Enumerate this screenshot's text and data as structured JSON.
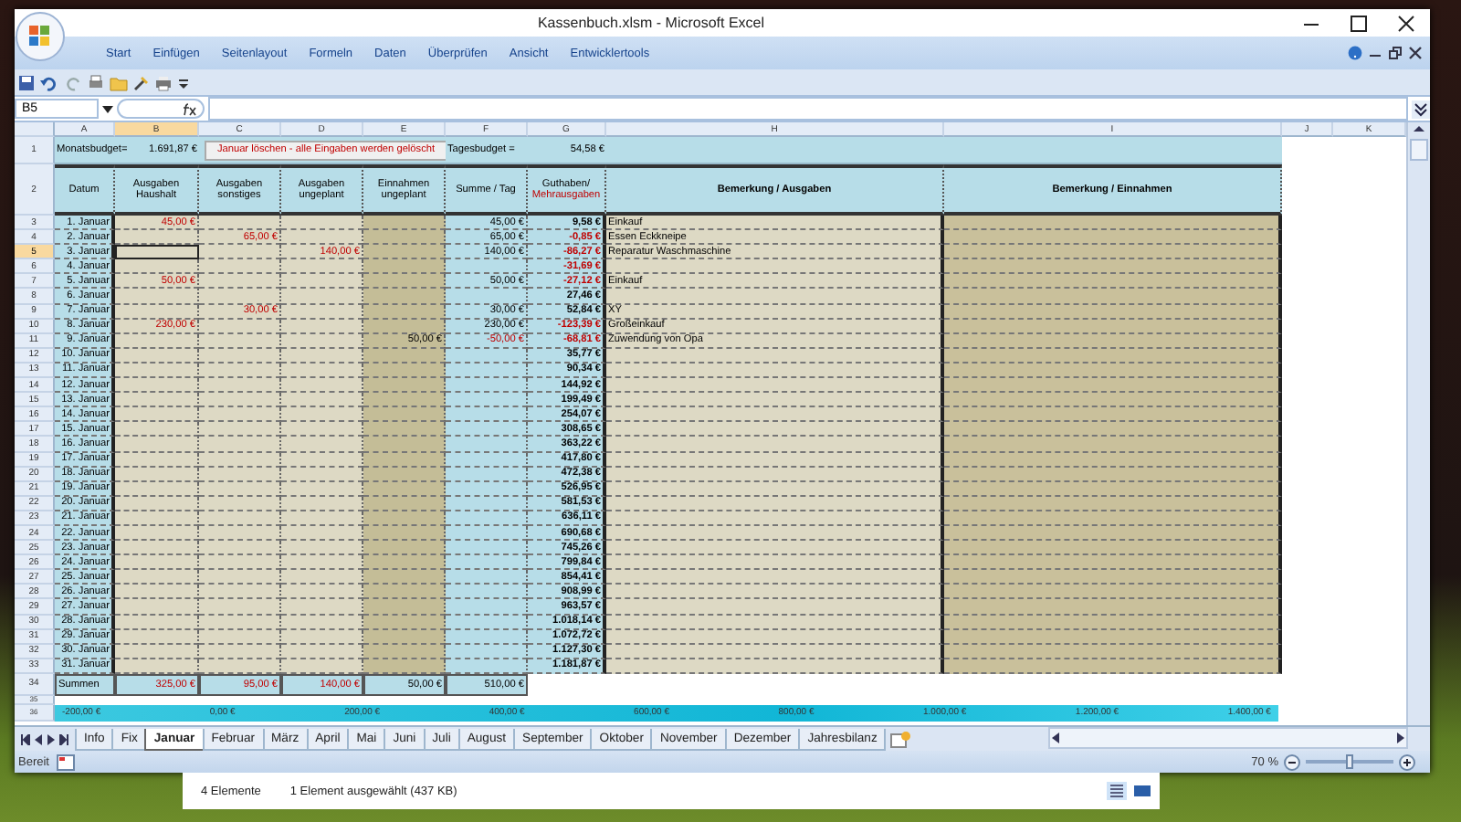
{
  "window": {
    "title": "Kassenbuch.xlsm - Microsoft Excel"
  },
  "ribbon_tabs": [
    {
      "label": "Start",
      "selected": false
    },
    {
      "label": "Einfügen",
      "selected": false
    },
    {
      "label": "Seitenlayout",
      "selected": false
    },
    {
      "label": "Formeln",
      "selected": false
    },
    {
      "label": "Daten",
      "selected": false
    },
    {
      "label": "Überprüfen",
      "selected": false
    },
    {
      "label": "Ansicht",
      "selected": false
    },
    {
      "label": "Entwicklertools",
      "selected": false
    }
  ],
  "formula_bar": {
    "name_box": "B5"
  },
  "columns": [
    {
      "label": "A",
      "selected": false
    },
    {
      "label": "B",
      "selected": true
    },
    {
      "label": "C",
      "selected": false
    },
    {
      "label": "D",
      "selected": false
    },
    {
      "label": "E",
      "selected": false
    },
    {
      "label": "F",
      "selected": false
    },
    {
      "label": "G",
      "selected": false
    },
    {
      "label": "H",
      "selected": false
    },
    {
      "label": "I",
      "selected": false
    },
    {
      "label": "J",
      "selected": false
    },
    {
      "label": "K",
      "selected": false
    }
  ],
  "budget_row": {
    "row": "1",
    "label": "Monatsbudget=",
    "value": "1.691,87 €",
    "button": "Januar löschen - alle Eingaben werden gelöscht",
    "day_label": "Tagesbudget =",
    "day_value": "54,58 €"
  },
  "header_row": {
    "row": "2",
    "headers": [
      {
        "text": "Datum",
        "bold": false
      },
      {
        "text": "Ausgaben Haushalt",
        "bold": false
      },
      {
        "text": "Ausgaben sonstiges",
        "bold": false
      },
      {
        "text": "Ausgaben ungeplant",
        "bold": false
      },
      {
        "text": "Einnahmen ungeplant",
        "bold": false
      },
      {
        "text": "Summe / Tag",
        "bold": false
      },
      {
        "text": "Guthaben/",
        "second_line": "Mehrausgaben",
        "bold": false
      },
      {
        "text": "Bemerkung / Ausgaben",
        "bold": true
      },
      {
        "text": "Bemerkung / Einnahmen",
        "bold": true
      }
    ]
  },
  "rows": [
    {
      "row": "3",
      "date": "1. Januar",
      "selected": false,
      "cells": {
        "B": {
          "text": "45,00 €",
          "red": true
        },
        "F": {
          "text": "45,00 €",
          "red": false
        },
        "G": {
          "text": "9,58 €",
          "red": false
        },
        "H": {
          "text": "Einkauf",
          "red": false
        }
      }
    },
    {
      "row": "4",
      "date": "2. Januar",
      "selected": false,
      "cells": {
        "C": {
          "text": "65,00 €",
          "red": true
        },
        "F": {
          "text": "65,00 €",
          "red": false
        },
        "G": {
          "text": "-0,85 €",
          "red": true
        },
        "H": {
          "text": "Essen Eckkneipe",
          "red": false
        }
      }
    },
    {
      "row": "5",
      "date": "3. Januar",
      "selected": true,
      "cells": {
        "D": {
          "text": "140,00 €",
          "red": true
        },
        "F": {
          "text": "140,00 €",
          "red": false
        },
        "G": {
          "text": "-86,27 €",
          "red": true
        },
        "H": {
          "text": "Reparatur Waschmaschine",
          "red": false
        }
      }
    },
    {
      "row": "6",
      "date": "4. Januar",
      "selected": false,
      "cells": {
        "G": {
          "text": "-31,69 €",
          "red": true
        }
      }
    },
    {
      "row": "7",
      "date": "5. Januar",
      "selected": false,
      "cells": {
        "B": {
          "text": "50,00 €",
          "red": true
        },
        "F": {
          "text": "50,00 €",
          "red": false
        },
        "G": {
          "text": "-27,12 €",
          "red": true
        },
        "H": {
          "text": "Einkauf",
          "red": false
        }
      }
    },
    {
      "row": "8",
      "date": "6. Januar",
      "selected": false,
      "cells": {
        "G": {
          "text": "27,46 €",
          "red": false
        }
      }
    },
    {
      "row": "9",
      "date": "7. Januar",
      "selected": false,
      "cells": {
        "C": {
          "text": "30,00 €",
          "red": true
        },
        "F": {
          "text": "30,00 €",
          "red": false
        },
        "G": {
          "text": "52,84 €",
          "red": false
        },
        "H": {
          "text": "XY",
          "red": false
        }
      }
    },
    {
      "row": "10",
      "date": "8. Januar",
      "selected": false,
      "cells": {
        "B": {
          "text": "230,00 €",
          "red": true
        },
        "F": {
          "text": "230,00 €",
          "red": false
        },
        "G": {
          "text": "-123,39 €",
          "red": true
        },
        "H": {
          "text": "Großeinkauf",
          "red": false
        }
      }
    },
    {
      "row": "11",
      "date": "9. Januar",
      "selected": false,
      "cells": {
        "E": {
          "text": "50,00 €",
          "red": false
        },
        "F": {
          "text": "-50,00 €",
          "red": true
        },
        "G": {
          "text": "-68,81 €",
          "red": true
        },
        "H": {
          "text": "Zuwendung von Opa",
          "red": false
        }
      }
    },
    {
      "row": "12",
      "date": "10. Januar",
      "selected": false,
      "cells": {
        "G": {
          "text": "35,77 €",
          "red": false
        }
      }
    },
    {
      "row": "13",
      "date": "11. Januar",
      "selected": false,
      "cells": {
        "G": {
          "text": "90,34 €",
          "red": false
        }
      }
    },
    {
      "row": "14",
      "date": "12. Januar",
      "selected": false,
      "cells": {
        "G": {
          "text": "144,92 €",
          "red": false
        }
      }
    },
    {
      "row": "15",
      "date": "13. Januar",
      "selected": false,
      "cells": {
        "G": {
          "text": "199,49 €",
          "red": false
        }
      }
    },
    {
      "row": "16",
      "date": "14. Januar",
      "selected": false,
      "cells": {
        "G": {
          "text": "254,07 €",
          "red": false
        }
      }
    },
    {
      "row": "17",
      "date": "15. Januar",
      "selected": false,
      "cells": {
        "G": {
          "text": "308,65 €",
          "red": false
        }
      }
    },
    {
      "row": "18",
      "date": "16. Januar",
      "selected": false,
      "cells": {
        "G": {
          "text": "363,22 €",
          "red": false
        }
      }
    },
    {
      "row": "19",
      "date": "17. Januar",
      "selected": false,
      "cells": {
        "G": {
          "text": "417,80 €",
          "red": false
        }
      }
    },
    {
      "row": "20",
      "date": "18. Januar",
      "selected": false,
      "cells": {
        "G": {
          "text": "472,38 €",
          "red": false
        }
      }
    },
    {
      "row": "21",
      "date": "19. Januar",
      "selected": false,
      "cells": {
        "G": {
          "text": "526,95 €",
          "red": false
        }
      }
    },
    {
      "row": "22",
      "date": "20. Januar",
      "selected": false,
      "cells": {
        "G": {
          "text": "581,53 €",
          "red": false
        }
      }
    },
    {
      "row": "23",
      "date": "21. Januar",
      "selected": false,
      "cells": {
        "G": {
          "text": "636,11 €",
          "red": false
        }
      }
    },
    {
      "row": "24",
      "date": "22. Januar",
      "selected": false,
      "cells": {
        "G": {
          "text": "690,68 €",
          "red": false
        }
      }
    },
    {
      "row": "25",
      "date": "23. Januar",
      "selected": false,
      "cells": {
        "G": {
          "text": "745,26 €",
          "red": false
        }
      }
    },
    {
      "row": "26",
      "date": "24. Januar",
      "selected": false,
      "cells": {
        "G": {
          "text": "799,84 €",
          "red": false
        }
      }
    },
    {
      "row": "27",
      "date": "25. Januar",
      "selected": false,
      "cells": {
        "G": {
          "text": "854,41 €",
          "red": false
        }
      }
    },
    {
      "row": "28",
      "date": "26. Januar",
      "selected": false,
      "cells": {
        "G": {
          "text": "908,99 €",
          "red": false
        }
      }
    },
    {
      "row": "29",
      "date": "27. Januar",
      "selected": false,
      "cells": {
        "G": {
          "text": "963,57 €",
          "red": false
        }
      }
    },
    {
      "row": "30",
      "date": "28. Januar",
      "selected": false,
      "cells": {
        "G": {
          "text": "1.018,14 €",
          "red": false
        }
      }
    },
    {
      "row": "31",
      "date": "29. Januar",
      "selected": false,
      "cells": {
        "G": {
          "text": "1.072,72 €",
          "red": false
        }
      }
    },
    {
      "row": "32",
      "date": "30. Januar",
      "selected": false,
      "cells": {
        "G": {
          "text": "1.127,30 €",
          "red": false
        }
      }
    },
    {
      "row": "33",
      "date": "31. Januar",
      "selected": false,
      "cells": {
        "G": {
          "text": "1.181,87 €",
          "red": false
        }
      }
    }
  ],
  "sum_row": {
    "row": "34",
    "label": "Summen",
    "values": [
      {
        "text": "325,00 €",
        "red": true
      },
      {
        "text": "95,00 €",
        "red": true
      },
      {
        "text": "140,00 €",
        "red": true
      },
      {
        "text": "50,00 €",
        "red": false
      },
      {
        "text": "510,00 €",
        "red": false
      }
    ]
  },
  "empty_row": {
    "row": "35"
  },
  "scale_row": {
    "row": "36",
    "labels": [
      "-200,00 €",
      "0,00 €",
      "200,00 €",
      "400,00 €",
      "600,00 €",
      "800,00 €",
      "1.000,00 €",
      "1.200,00 €",
      "1.400,00 €"
    ]
  },
  "sheet_tabs": [
    {
      "label": "Info",
      "selected": false
    },
    {
      "label": "Fix",
      "selected": false
    },
    {
      "label": "Januar",
      "selected": true
    },
    {
      "label": "Februar",
      "selected": false
    },
    {
      "label": "März",
      "selected": false
    },
    {
      "label": "April",
      "selected": false
    },
    {
      "label": "Mai",
      "selected": false
    },
    {
      "label": "Juni",
      "selected": false
    },
    {
      "label": "Juli",
      "selected": false
    },
    {
      "label": "August",
      "selected": false
    },
    {
      "label": "September",
      "selected": false
    },
    {
      "label": "Oktober",
      "selected": false
    },
    {
      "label": "November",
      "selected": false
    },
    {
      "label": "Dezember",
      "selected": false
    },
    {
      "label": "Jahresbilanz",
      "selected": false
    }
  ],
  "status_bar": {
    "text": "Bereit",
    "zoom": "70 %",
    "zoom_level": {
      "level": 0.5
    }
  },
  "explorer_status": {
    "count": "4 Elemente",
    "selection": "1 Element ausgewählt (437 KB)"
  }
}
